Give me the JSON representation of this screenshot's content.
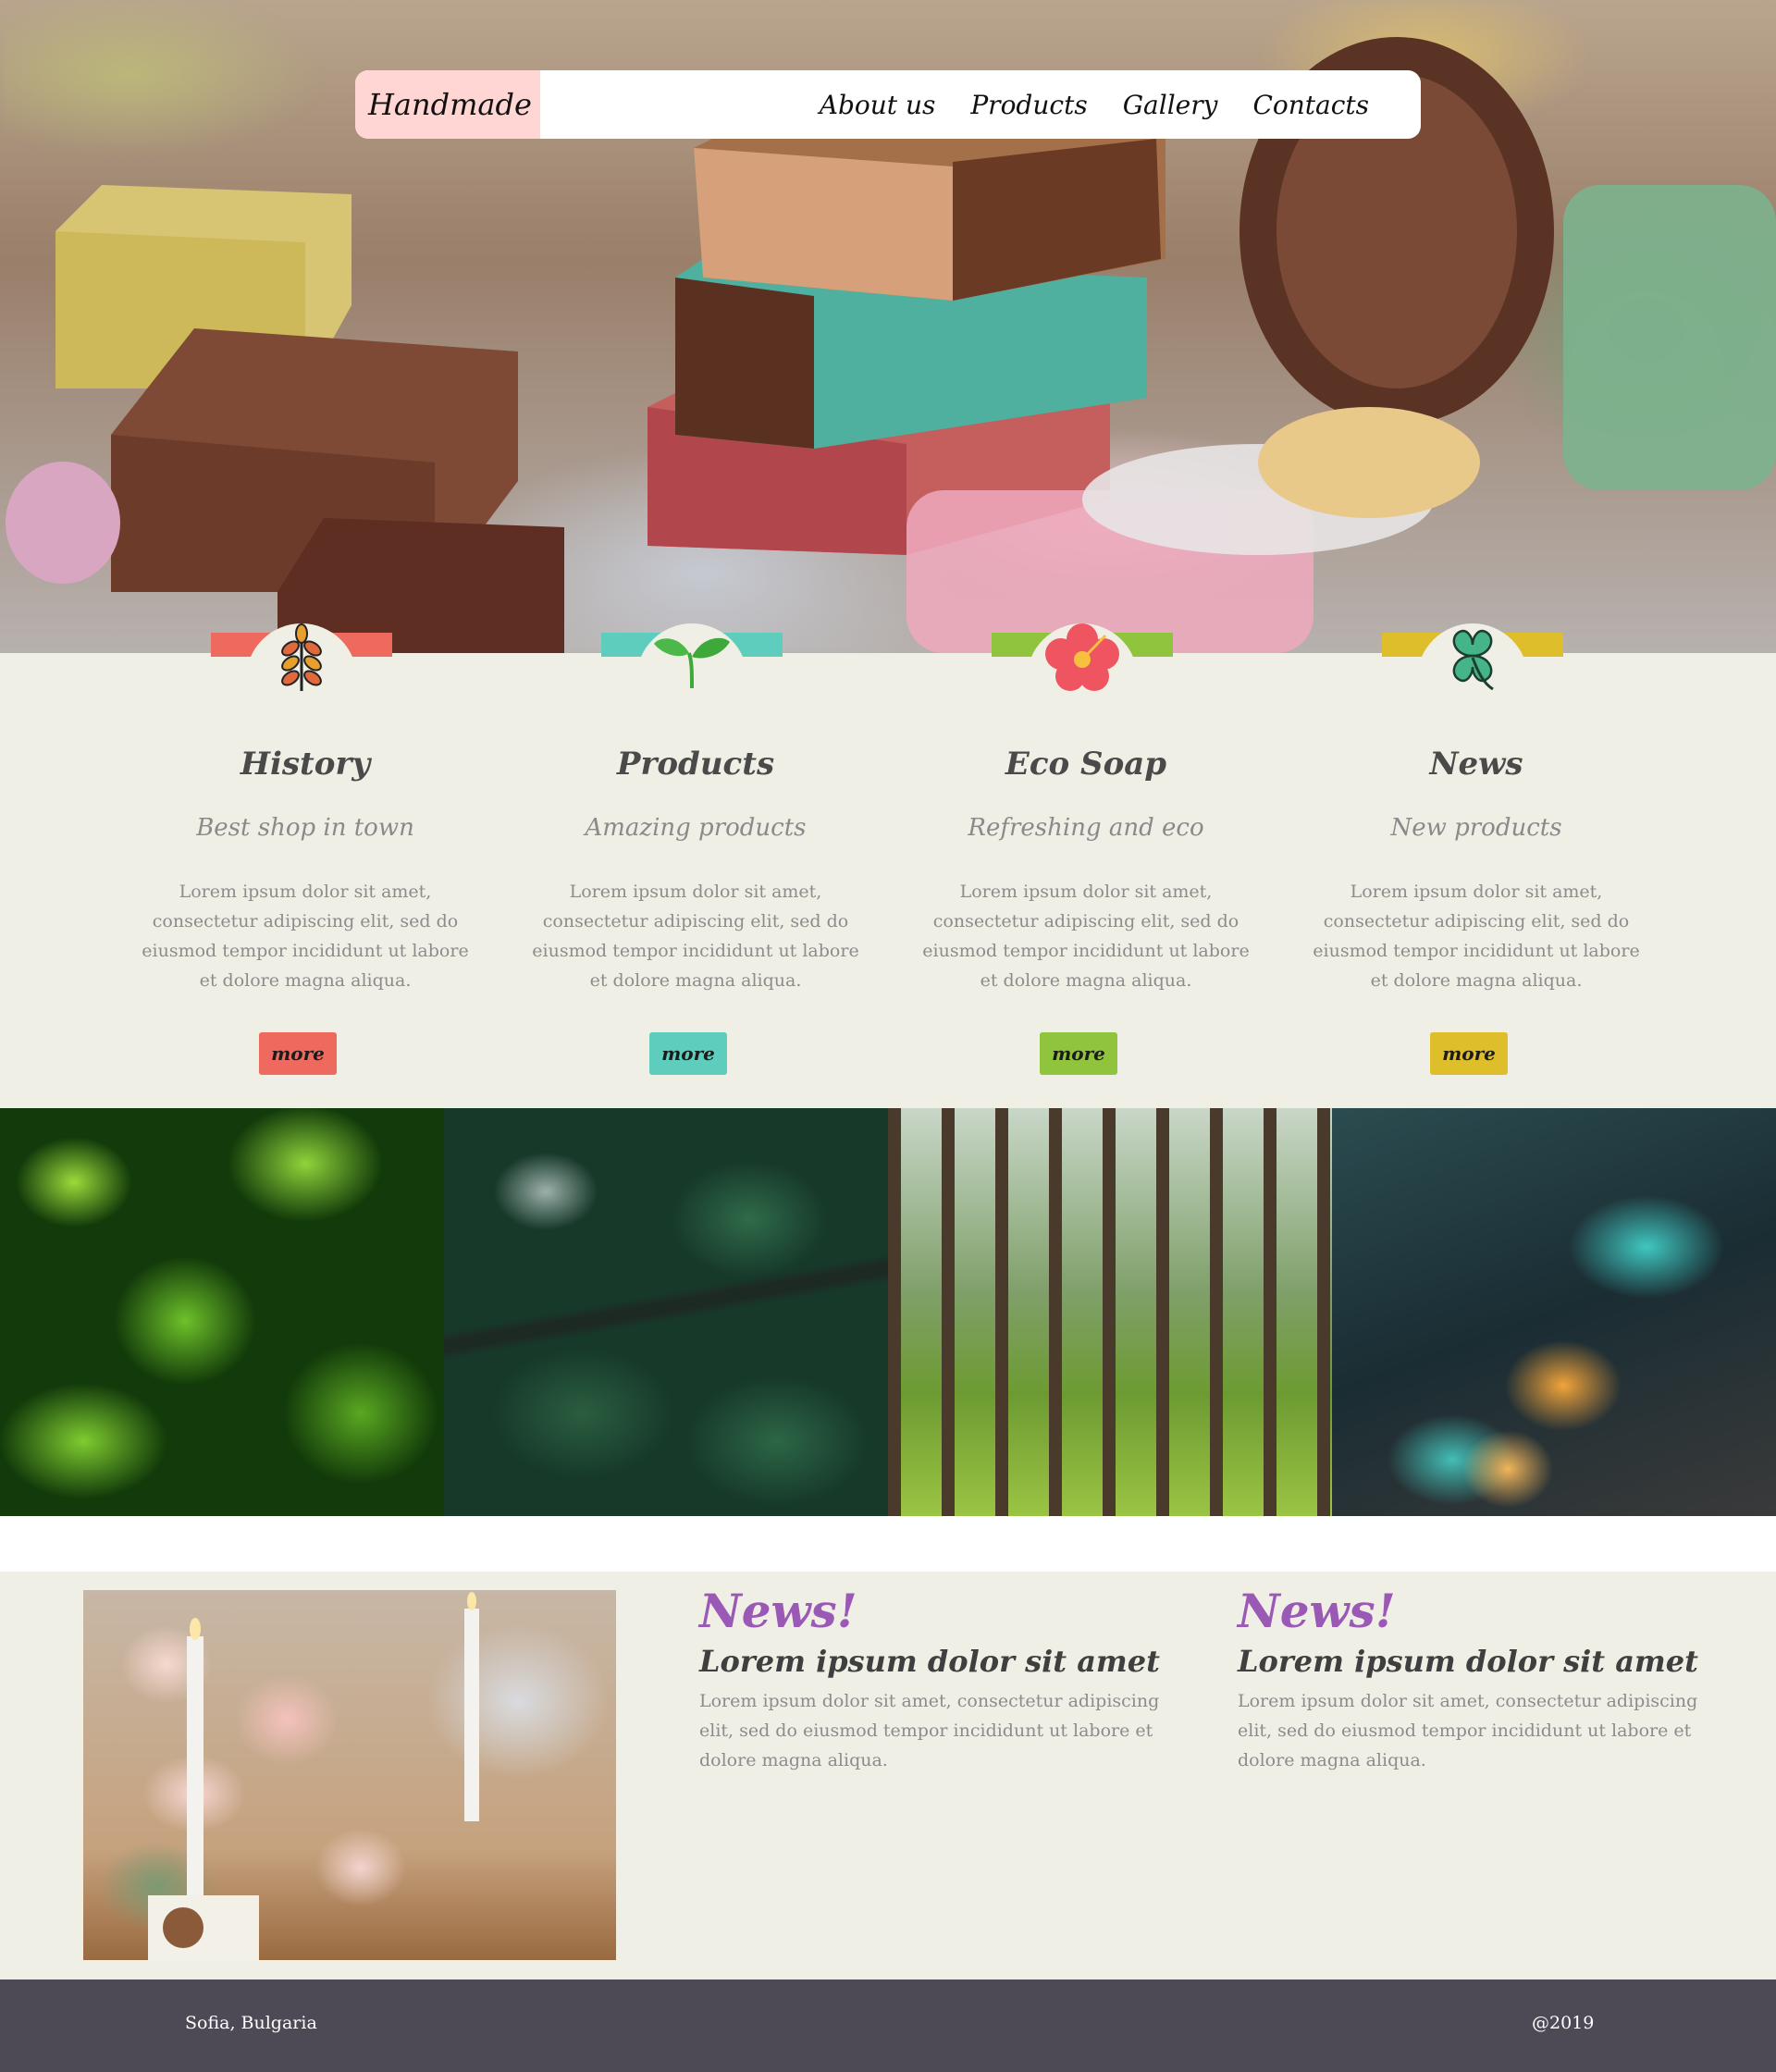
{
  "nav": {
    "brand": "Handmade",
    "brand_icon": "heart-icon",
    "links": [
      "About us",
      "Products",
      "Gallery",
      "Contacts"
    ]
  },
  "features": [
    {
      "icon": "wheat-icon",
      "accent": "#ee6a5f",
      "title": "History",
      "subtitle": "Best shop in town",
      "body": "Lorem ipsum dolor sit amet, consectetur adipiscing elit, sed do eiusmod tempor incididunt ut labore et dolore magna aliqua.",
      "button": "more"
    },
    {
      "icon": "sprout-icon",
      "accent": "#5ecdbe",
      "title": "Products",
      "subtitle": "Amazing products",
      "body": "Lorem ipsum dolor sit amet, consectetur adipiscing elit, sed do eiusmod tempor incididunt ut labore et dolore magna aliqua.",
      "button": "more"
    },
    {
      "icon": "hibiscus-icon",
      "accent": "#8fc43c",
      "title": "Eco Soap",
      "subtitle": "Refreshing and eco",
      "body": "Lorem ipsum dolor sit amet, consectetur adipiscing elit, sed do eiusmod tempor incididunt ut labore et dolore magna aliqua.",
      "button": "more"
    },
    {
      "icon": "clover-icon",
      "accent": "#dfbe2c",
      "title": "News",
      "subtitle": "New products",
      "body": "Lorem ipsum dolor sit amet, consectetur adipiscing elit, sed do eiusmod tempor incididunt ut labore et dolore magna aliqua.",
      "button": "more"
    }
  ],
  "gallery": [
    "leaves-photo",
    "forest-aerial-photo",
    "pine-forest-photo",
    "city-night-photo"
  ],
  "news": [
    {
      "heading": "News!",
      "title": "Lorem ipsum dolor sit amet",
      "body": "Lorem ipsum dolor sit amet, consectetur adipiscing elit, sed do eiusmod tempor incididunt ut labore et dolore magna aliqua."
    },
    {
      "heading": "News!",
      "title": "Lorem ipsum dolor sit amet",
      "body": "Lorem ipsum dolor sit amet, consectetur adipiscing elit, sed do eiusmod tempor incididunt ut labore et dolore magna aliqua."
    }
  ],
  "footer": {
    "location": "Sofia, Bulgaria",
    "copyright": "@2019"
  }
}
